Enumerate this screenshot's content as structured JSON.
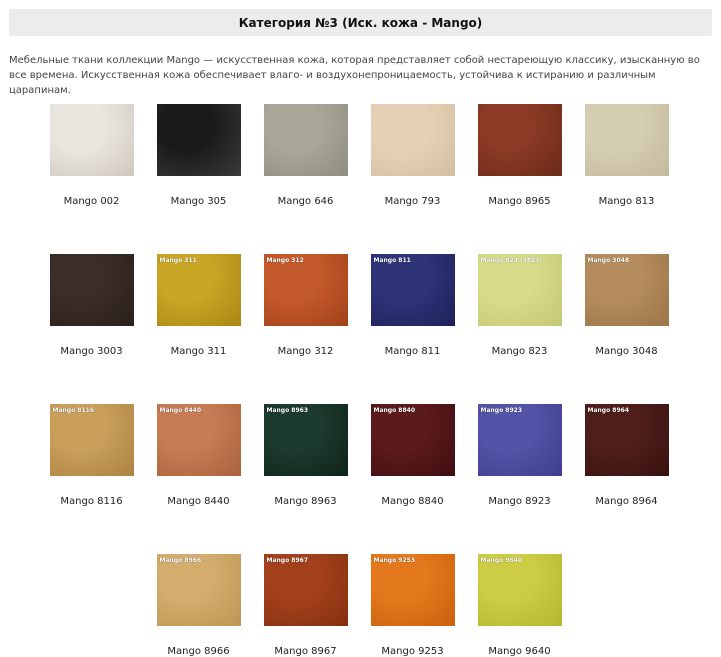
{
  "title": "Категория №3 (Иск. кожа - Mango)",
  "description": "Мебельные ткани коллекции Mango — искусственная кожа, которая представляет собой нестареющую классику, изысканную во все времена. Искусственная кожа обеспечивает влаго- и воздухонепроницаемость, устойчива к истиранию и различным царапинам.",
  "swatches": [
    {
      "name": "Mango 002",
      "tag": "",
      "color": "#e9e5df",
      "shade": "#cfc8bd"
    },
    {
      "name": "Mango 305",
      "tag": "",
      "color": "#1a1a1a",
      "shade": "#3a3a3a"
    },
    {
      "name": "Mango 646",
      "tag": "",
      "color": "#aaa79a",
      "shade": "#8f8c80"
    },
    {
      "name": "Mango 793",
      "tag": "",
      "color": "#e5d2b6",
      "shade": "#d3bd9f"
    },
    {
      "name": "Mango 8965",
      "tag": "",
      "color": "#8a3a25",
      "shade": "#6c2a19"
    },
    {
      "name": "Mango 813",
      "tag": "",
      "color": "#d6ceb3",
      "shade": "#c3b99c"
    },
    {
      "name": "Mango 3003",
      "tag": "",
      "color": "#3b2d27",
      "shade": "#2a1f1a"
    },
    {
      "name": "Mango 311",
      "tag": "Mango 311",
      "color": "#c9a626",
      "shade": "#a88713"
    },
    {
      "name": "Mango 312",
      "tag": "Mango 312",
      "color": "#c45a2b",
      "shade": "#a0401a"
    },
    {
      "name": "Mango 811",
      "tag": "Mango 811",
      "color": "#2f3479",
      "shade": "#1c2058"
    },
    {
      "name": "Mango 823",
      "tag": "Mango 823 (3823)",
      "color": "#d8dc8a",
      "shade": "#c4c876"
    },
    {
      "name": "Mango 3048",
      "tag": "Mango 3048",
      "color": "#b58d5d",
      "shade": "#9a7447"
    },
    {
      "name": "Mango 8116",
      "tag": "Mango 8116",
      "color": "#c99f5a",
      "shade": "#ab8244"
    },
    {
      "name": "Mango 8440",
      "tag": "Mango 8440",
      "color": "#c77c54",
      "shade": "#a8623c"
    },
    {
      "name": "Mango 8963",
      "tag": "Mango 8963",
      "color": "#1c3a2d",
      "shade": "#0f2419"
    },
    {
      "name": "Mango 8840",
      "tag": "Mango 8840",
      "color": "#5c1a1c",
      "shade": "#3f0e10"
    },
    {
      "name": "Mango 8923",
      "tag": "Mango 8923",
      "color": "#5354a8",
      "shade": "#3d3e8a"
    },
    {
      "name": "Mango 8964",
      "tag": "Mango 8964",
      "color": "#4f1e1a",
      "shade": "#381210"
    },
    {
      "name": "Mango 8966",
      "tag": "Mango 8966",
      "color": "#d3ad6d",
      "shade": "#bd9555"
    },
    {
      "name": "Mango 8967",
      "tag": "Mango 8967",
      "color": "#a3401c",
      "shade": "#84300f"
    },
    {
      "name": "Mango 9253",
      "tag": "Mango 9253",
      "color": "#e4781c",
      "shade": "#c8600d"
    },
    {
      "name": "Mango 9640",
      "tag": "Mango 9640",
      "color": "#cccd45",
      "shade": "#b4b531"
    }
  ]
}
